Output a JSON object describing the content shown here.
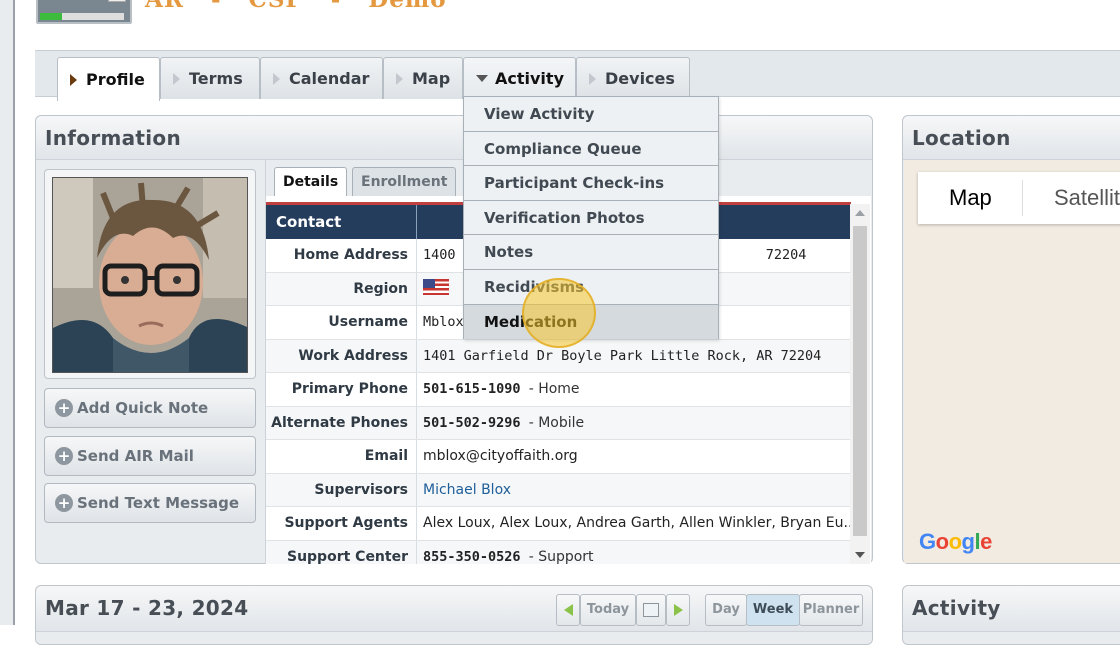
{
  "app": {
    "title": "AR - CSP - Demo"
  },
  "tabs": [
    {
      "label": "Profile"
    },
    {
      "label": "Terms"
    },
    {
      "label": "Calendar"
    },
    {
      "label": "Map"
    },
    {
      "label": "Activity"
    },
    {
      "label": "Devices"
    }
  ],
  "activity_menu": [
    "View Activity",
    "Compliance Queue",
    "Participant Check-ins",
    "Verification Photos",
    "Notes",
    "Recidivisms",
    "Medication"
  ],
  "information": {
    "title": "Information",
    "actions": {
      "quick_note": "Add Quick Note",
      "air_mail": "Send AIR Mail",
      "text_message": "Send Text Message"
    },
    "subtabs": {
      "details": "Details",
      "enrollment": "Enrollment"
    },
    "contact_header": "Contact",
    "rows": {
      "home_address_label": "Home Address",
      "home_address_start": "1400",
      "home_address_end": "72204",
      "region_label": "Region",
      "username_label": "Username",
      "username_value": "Mblox",
      "work_address_label": "Work Address",
      "work_address_value": "1401 Garfield Dr Boyle Park Little Rock, AR 72204",
      "primary_phone_label": "Primary Phone",
      "primary_phone_number": "501-615-1090",
      "primary_phone_type": "- Home",
      "alternate_phones_label": "Alternate Phones",
      "alternate_phone_number": "501-502-9296",
      "alternate_phone_type": "- Mobile",
      "email_label": "Email",
      "email_value": "mblox@cityoffaith.org",
      "supervisors_label": "Supervisors",
      "supervisors_value": "Michael Blox",
      "support_agents_label": "Support Agents",
      "support_agents_value": "Alex Loux, Alex Loux, Andrea Garth, Allen Winkler, Bryan Eu...",
      "support_center_label": "Support Center",
      "support_center_number": "855-350-0526",
      "support_center_type": "- Support"
    }
  },
  "location": {
    "title": "Location",
    "map_btn": "Map",
    "satellite_btn": "Satellite",
    "google_logo": "Google"
  },
  "calendar": {
    "range": "Mar 17 - 23, 2024",
    "today": "Today",
    "day": "Day",
    "week": "Week",
    "planner": "Planner"
  },
  "activity_panel": {
    "title": "Activity"
  },
  "colors": {
    "brand": "#e4983f",
    "contact_header": "#253d5c",
    "link": "#1f5f9a",
    "cursor_highlight": "#f6c62d"
  }
}
